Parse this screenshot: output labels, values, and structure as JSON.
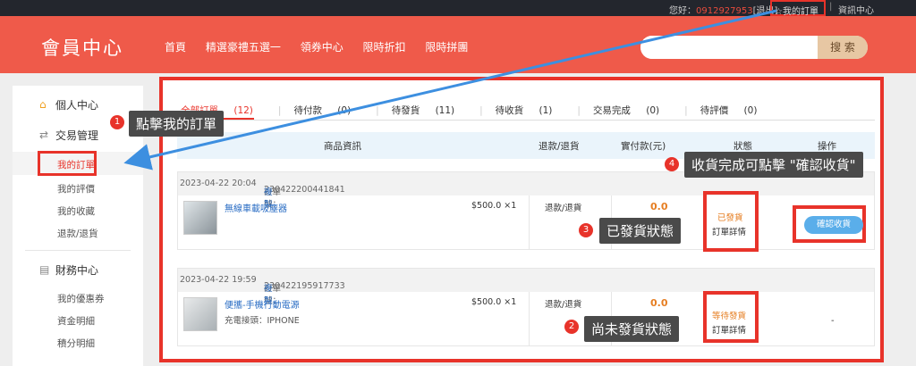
{
  "topbar": {
    "greeting": "您好：",
    "phone": "0912927953",
    "logout": "[退出]",
    "my_order": "我的訂單",
    "info": "資訊中心"
  },
  "header": {
    "logo": "會員中心",
    "nav": [
      "首頁",
      "精選豪禮五選一",
      "領券中心",
      "限時折扣",
      "限時拼團"
    ],
    "search_button": "搜 索",
    "search_placeholder": ""
  },
  "sidebar": {
    "personal": "個人中心",
    "trade": "交易管理",
    "trade_items": [
      "我的訂單",
      "我的評價",
      "我的收藏",
      "退款/退貨"
    ],
    "finance": "財務中心",
    "finance_items": [
      "我的優惠券",
      "資金明細",
      "積分明細"
    ]
  },
  "tabs": [
    {
      "label": "全部訂單",
      "count": "(12)"
    },
    {
      "label": "待付款",
      "count": "(0)"
    },
    {
      "label": "待發貨",
      "count": "(11)"
    },
    {
      "label": "待收貨",
      "count": "(1)"
    },
    {
      "label": "交易完成",
      "count": "(0)"
    },
    {
      "label": "待評價",
      "count": "(0)"
    }
  ],
  "table_headers": [
    "商品資訊",
    "退款/退貨",
    "實付款(元)",
    "狀態",
    "操作"
  ],
  "orders": [
    {
      "date": "2023-04-22 20:04",
      "order_no_label": "訂單號：",
      "order_no": "230422200441841",
      "copy": "複製",
      "product": "無線車載吸塵器",
      "spec": "",
      "price": "$500.0 ×1",
      "refund": "退款/退貨",
      "amount": "0.0",
      "status": "已發貨",
      "detail": "訂單詳情",
      "action": "確認收貨"
    },
    {
      "date": "2023-04-22 19:59",
      "order_no_label": "訂單號：",
      "order_no": "230422195917733",
      "copy": "複製",
      "product": "便攜-手機行動電源",
      "spec": "充電接頭：IPHONE",
      "price": "$500.0 ×1",
      "refund": "退款/退貨",
      "amount": "0.0",
      "status": "等待發貨",
      "detail": "訂單詳情",
      "action": "-"
    }
  ],
  "callouts": [
    {
      "num": "1",
      "text": "點擊我的訂單"
    },
    {
      "num": "2",
      "text": "尚未發貨狀態"
    },
    {
      "num": "3",
      "text": "已發貨狀態"
    },
    {
      "num": "4",
      "text": "收貨完成可點擊 \"確認收貨\""
    }
  ],
  "colors": {
    "accent": "#ef5a4a",
    "highlight": "#e8332a",
    "button": "#5aaeea",
    "arrow": "#3d8fe0"
  }
}
